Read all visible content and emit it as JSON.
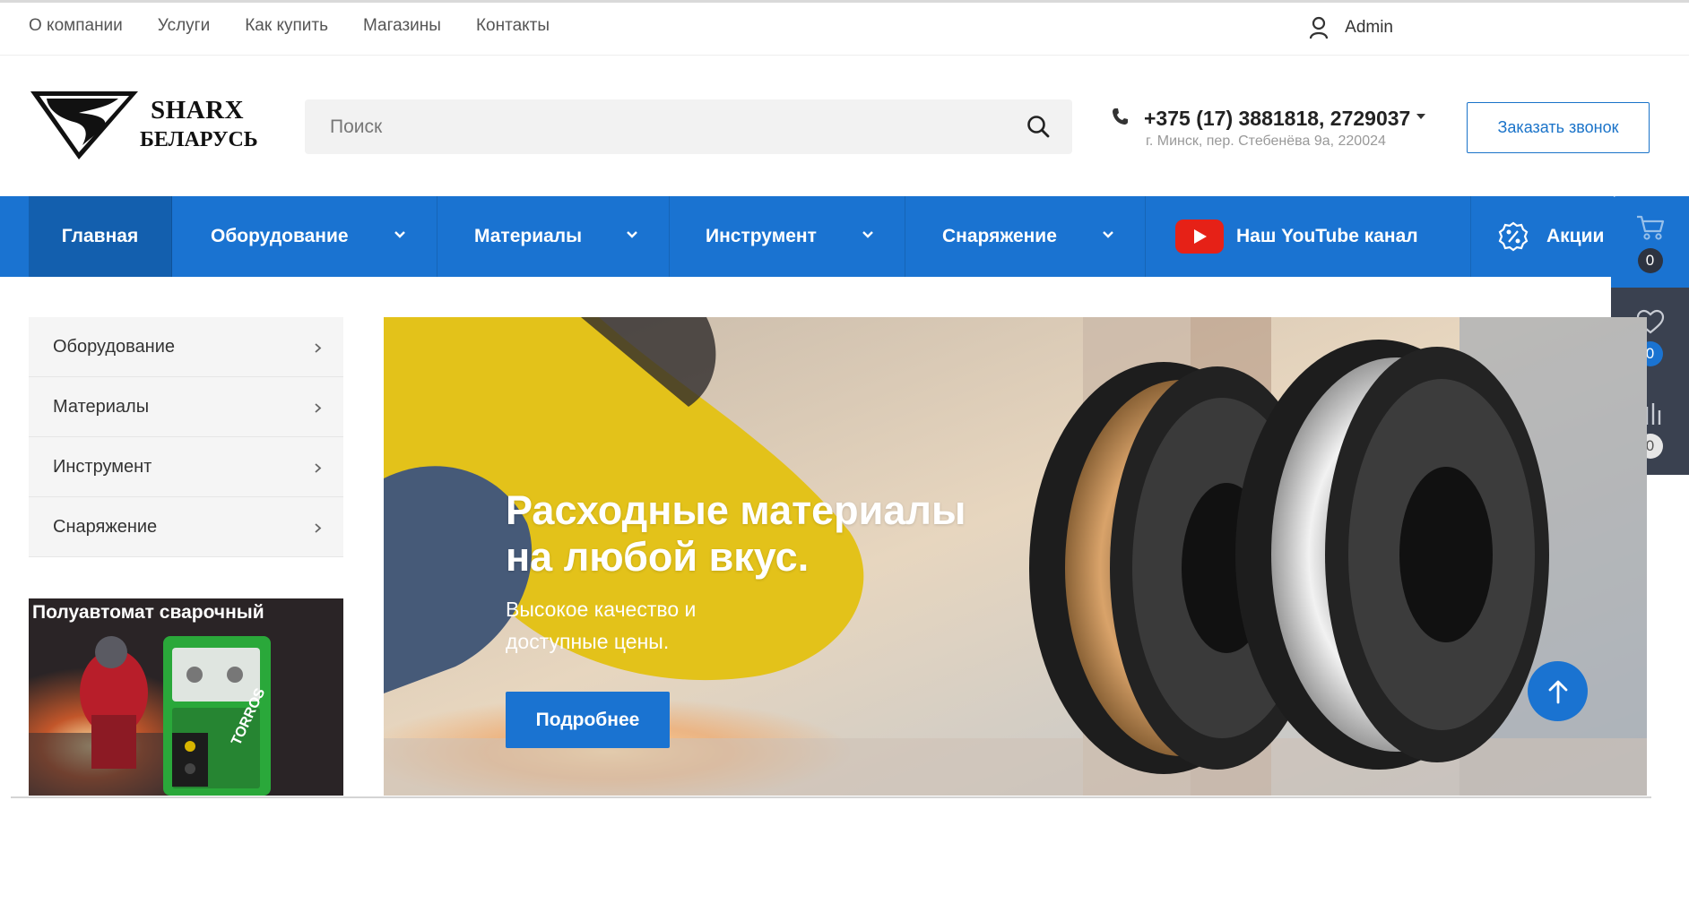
{
  "top_nav": [
    "О компании",
    "Услуги",
    "Как купить",
    "Магазины",
    "Контакты"
  ],
  "user": {
    "name": "Admin",
    "icon": "user-icon"
  },
  "logo": {
    "line1": "SHARX",
    "line2": "БЕЛАРУСЬ"
  },
  "search": {
    "placeholder": "Поиск",
    "icon": "search-icon"
  },
  "contacts": {
    "phone": "+375 (17) 3881818, 2729037",
    "address": "г. Минск, пер. Стебенёва 9а, 220024",
    "callback_label": "Заказать звонок"
  },
  "main_nav": [
    {
      "label": "Главная",
      "active": true
    },
    {
      "label": "Оборудование",
      "dropdown": true
    },
    {
      "label": "Материалы",
      "dropdown": true
    },
    {
      "label": "Инструмент",
      "dropdown": true
    },
    {
      "label": "Снаряжение",
      "dropdown": true
    },
    {
      "label": "Наш YouTube канал",
      "icon": "youtube-icon"
    },
    {
      "label": "Акции",
      "icon": "percent-icon"
    }
  ],
  "side_widget": {
    "cart_count": "0",
    "favorites_count": "0",
    "compare_count": "0"
  },
  "catalog_menu": [
    "Оборудование",
    "Материалы",
    "Инструмент",
    "Снаряжение"
  ],
  "promo": {
    "title": "Полуавтомат сварочный",
    "brand": "TORROS"
  },
  "hero": {
    "title": "Расходные материалы\nна любой вкус.",
    "subtitle": "Высокое качество и\nдоступные цены.",
    "button": "Подробнее"
  },
  "colors": {
    "accent": "#1a73d1",
    "nav_active": "#135fae",
    "side_dark": "#3a4150"
  }
}
